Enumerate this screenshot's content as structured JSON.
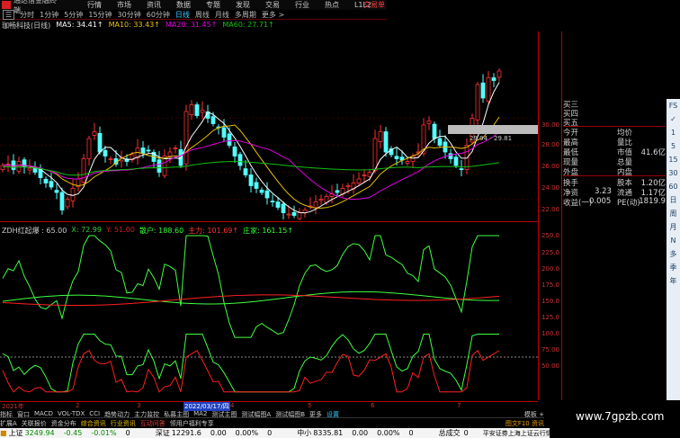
{
  "titlebar": {
    "app": "通达信金融终端",
    "menus": [
      "行情",
      "市场",
      "资讯",
      "数据",
      "专题",
      "发现",
      "交易",
      "行业",
      "热点",
      "L1L2"
    ],
    "trade": "交易单"
  },
  "periods": {
    "items": [
      "分时",
      "1分钟",
      "5分钟",
      "15分钟",
      "30分钟",
      "60分钟",
      "日线",
      "周线",
      "月线",
      "多周期",
      "更多 >"
    ],
    "active": "日线"
  },
  "ma_legend": {
    "name": "珈畅科技(日线)",
    "ma5": "MA5: 34.41↑",
    "ma10": "MA10: 33.43↑",
    "ma20": "MA20: 31.45↑",
    "ma60": "MA60: 27.71↑"
  },
  "colors": {
    "up": "#ff3232",
    "down": "#54ffff",
    "ma5": "#ffffff",
    "ma10": "#e8c000",
    "ma20": "#e000e0",
    "ma60": "#10c010",
    "axis": "#c03030"
  },
  "price_axis": [
    "30.00",
    "28.00",
    "26.00",
    "24.00",
    "22.00"
  ],
  "tooltip": "29.94 - 29.81",
  "info": {
    "rows": [
      [
        "买三",
        "",
        ""
      ],
      [
        "买四",
        "",
        ""
      ],
      [
        "买五",
        "",
        ""
      ],
      [
        "今开",
        "均价",
        ""
      ],
      [
        "最高",
        "量比",
        ""
      ],
      [
        "最低",
        "市值",
        "41.6亿"
      ],
      [
        "现量",
        "总量",
        ""
      ],
      [
        "外盘",
        "内盘",
        ""
      ],
      [
        "换手",
        "股本",
        "1.20亿"
      ],
      [
        "净资",
        "3.23",
        "流通",
        "1.17亿"
      ],
      [
        "收益(一)",
        "0.005",
        "PE(动)",
        "1819.9"
      ]
    ]
  },
  "indicator": {
    "name": "ZDH红起爆 : 65.00",
    "x": "X: 72.99",
    "y": "Y: 51.00",
    "a": "散户: 188.60",
    "b": "主力: 101.69↑",
    "c": "庄家: 161.15↑",
    "axis": [
      "250.0",
      "225.0",
      "200.0",
      "175.0",
      "150.0",
      "125.0",
      "100.0",
      "75.00",
      "50.00"
    ]
  },
  "dates": [
    "2021年",
    "2",
    "3",
    "2022/03/17/四",
    "4",
    "5",
    "6",
    "7"
  ],
  "toolbar": [
    "FS",
    "✓",
    "1",
    "5",
    "15",
    "30",
    "60",
    "日",
    "周",
    "月",
    "N",
    "多",
    "季",
    "年"
  ],
  "tabs1": [
    "指标",
    "窗口",
    "MACD",
    "VOL-TDX",
    "CCI",
    "趋势动力",
    "主力监控",
    "私募主图",
    "MA2",
    "测试主图",
    "测试幅图A",
    "测试幅图B",
    "更多",
    "设置"
  ],
  "tabs1_right": "模板 +",
  "tabs2": [
    "扩展A",
    "关联报价",
    "资金分布",
    "综合资讯",
    "行业资讯",
    "互动问答",
    "领用户福利专享"
  ],
  "tabs2_right": "图文F10 资讯",
  "status": {
    "sh_name": "上证",
    "sh": "3249.94",
    "sh_chg": "-0.45",
    "sh_pct": "-0.01%",
    "sh_vol": "0",
    "sz_name": "深证",
    "sz": "12291.6",
    "sz_chg": "0.00",
    "sz_pct": "0.00%",
    "sz_vol": "0",
    "zx_name": "中小",
    "zx": "8335.81",
    "zx_chg": "0.00",
    "zx_pct": "0.00%",
    "zx_vol": "0",
    "total_label": "总成交",
    "total": "0",
    "news": "平安证券上海上证云行情"
  },
  "watermark": "www.7gpzb.com",
  "chart_data": {
    "type": "candlestick",
    "closes": [
      26.5,
      26.6,
      26.2,
      26.8,
      26.4,
      26.3,
      26.0,
      25.6,
      25.2,
      24.9,
      24.5,
      23.2,
      24.0,
      24.8,
      25.5,
      27.0,
      28.5,
      29.0,
      27.5,
      27.2,
      27.0,
      26.6,
      27.1,
      26.8,
      27.3,
      27.8,
      27.4,
      27.6,
      26.8,
      26.0,
      27.2,
      27.5,
      27.8,
      26.5,
      30.5,
      31.0,
      30.2,
      30.6,
      30.0,
      29.6,
      29.3,
      28.6,
      28.0,
      27.2,
      26.5,
      25.8,
      25.0,
      24.8,
      24.5,
      24.1,
      23.8,
      23.4,
      23.0,
      22.9,
      22.8,
      23.0,
      23.2,
      23.5,
      23.8,
      24.0,
      24.2,
      24.4,
      24.5,
      24.8,
      25.0,
      25.2,
      25.5,
      25.8,
      26.0,
      28.5,
      29.0,
      27.5,
      27.3,
      27.0,
      26.9,
      26.8,
      27.2,
      27.5,
      29.5,
      29.8,
      28.5,
      28.0,
      27.5,
      27.0,
      26.5,
      26.2,
      28.0,
      30.0,
      32.5,
      31.5,
      33.0,
      32.8,
      33.5
    ],
    "ylim": [
      21.5,
      35.5
    ]
  }
}
